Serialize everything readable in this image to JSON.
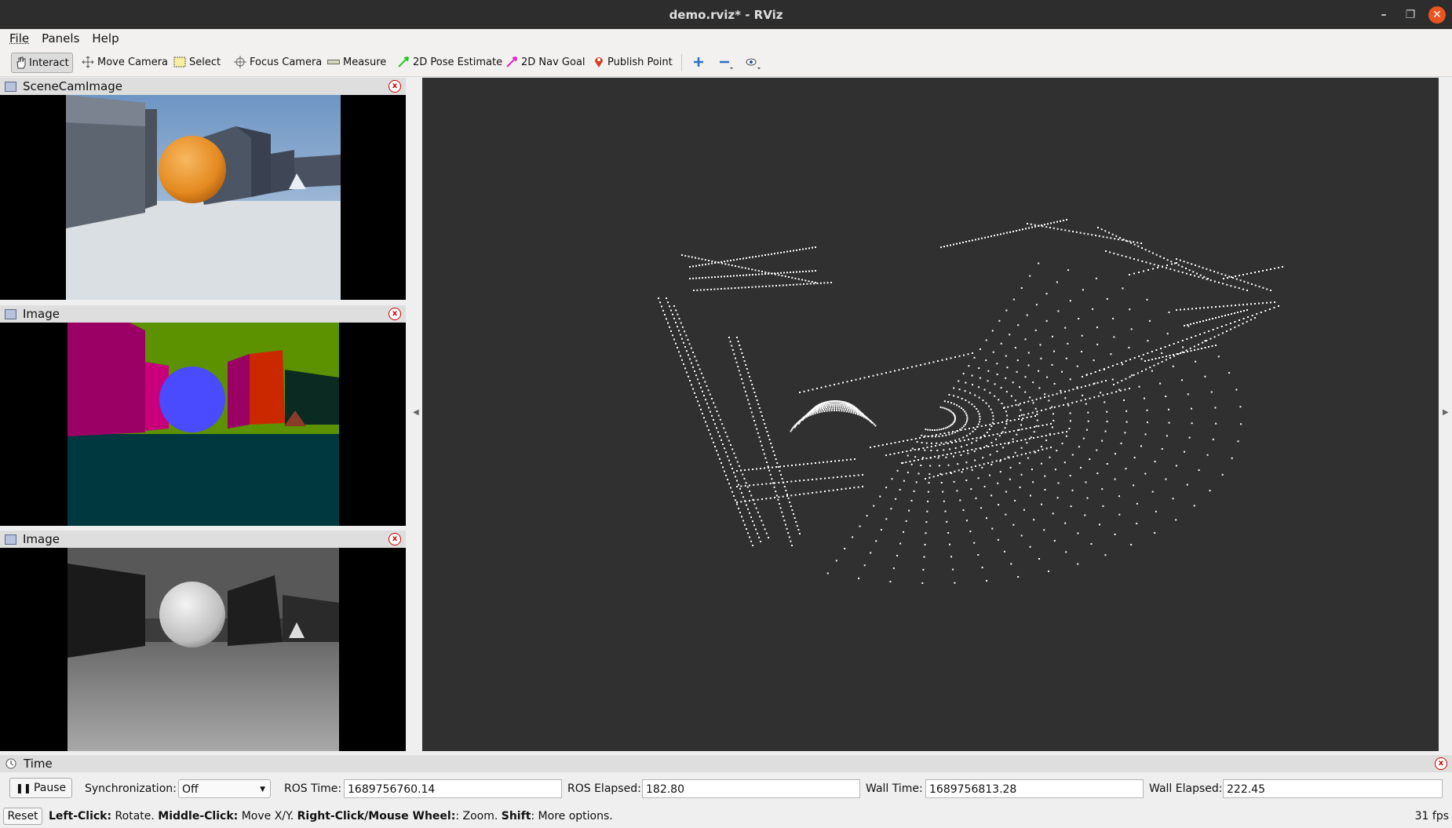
{
  "window": {
    "title": "demo.rviz* - RViz"
  },
  "menu": [
    {
      "label": "File"
    },
    {
      "label": "Panels"
    },
    {
      "label": "Help"
    }
  ],
  "toolbar": {
    "tools": [
      {
        "label": "Interact",
        "icon": "hand-icon"
      },
      {
        "label": "Move Camera",
        "icon": "move-camera-icon"
      },
      {
        "label": "Select",
        "icon": "select-box-icon"
      },
      {
        "label": "Focus Camera",
        "icon": "crosshair-icon"
      },
      {
        "label": "Measure",
        "icon": "ruler-icon"
      },
      {
        "label": "2D Pose Estimate",
        "icon": "green-arrow-icon"
      },
      {
        "label": "2D Nav Goal",
        "icon": "magenta-arrow-icon"
      },
      {
        "label": "Publish Point",
        "icon": "map-pin-icon"
      }
    ],
    "extra_icons": [
      "plus-icon",
      "minus-icon",
      "eye-icon"
    ]
  },
  "panels": [
    {
      "title": "SceneCamImage"
    },
    {
      "title": "Image"
    },
    {
      "title": "Image"
    }
  ],
  "time": {
    "title": "Time",
    "pause_label": "Pause",
    "sync_label": "Synchronization:",
    "sync_value": "Off",
    "ros_time_label": "ROS Time:",
    "ros_time": "1689756760.14",
    "ros_elapsed_label": "ROS Elapsed:",
    "ros_elapsed": "182.80",
    "wall_time_label": "Wall Time:",
    "wall_time": "1689756813.28",
    "wall_elapsed_label": "Wall Elapsed:",
    "wall_elapsed": "222.45"
  },
  "status": {
    "reset_label": "Reset",
    "hint_left_key": "Left-Click:",
    "hint_left": " Rotate. ",
    "hint_middle_key": "Middle-Click:",
    "hint_middle": " Move X/Y. ",
    "hint_right_key": "Right-Click/Mouse Wheel:",
    "hint_right": ": Zoom. ",
    "hint_shift_key": "Shift",
    "hint_shift": ": More options.",
    "fps": "31 fps"
  },
  "colors": {
    "view_bg": "#303030",
    "close_accent": "#e95420"
  }
}
